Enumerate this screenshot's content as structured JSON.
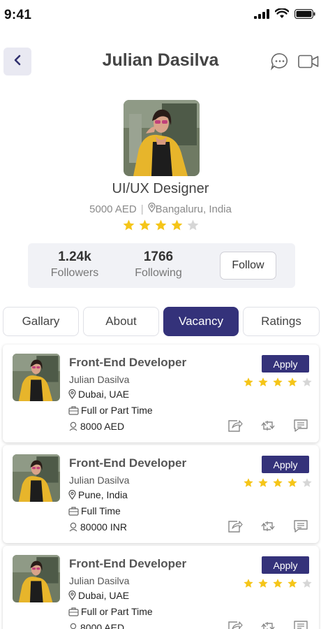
{
  "status": {
    "time": "9:41"
  },
  "header": {
    "title": "Julian Dasilva"
  },
  "profile": {
    "role": "UI/UX Designer",
    "salary": "5000 AED",
    "location": "Bangaluru, India",
    "rating": 4,
    "rating_max": 5
  },
  "stats": {
    "followers_count": "1.24k",
    "followers_label": "Followers",
    "following_count": "1766",
    "following_label": "Following",
    "follow_label": "Follow"
  },
  "tabs": [
    {
      "label": "Gallary",
      "active": false
    },
    {
      "label": "About",
      "active": false
    },
    {
      "label": "Vacancy",
      "active": true
    },
    {
      "label": "Ratings",
      "active": false
    }
  ],
  "jobs": [
    {
      "title": "Front-End Developer",
      "company": "Julian Dasilva",
      "location": "Dubai, UAE",
      "type": "Full or Part Time",
      "salary": "8000 AED",
      "apply_label": "Apply",
      "rating": 4
    },
    {
      "title": "Front-End Developer",
      "company": "Julian Dasilva",
      "location": "Pune, India",
      "type": "Full Time",
      "salary": "80000 INR",
      "apply_label": "Apply",
      "rating": 4
    },
    {
      "title": "Front-End Developer",
      "company": "Julian Dasilva",
      "location": "Dubai, UAE",
      "type": "Full or Part Time",
      "salary": "8000 AED",
      "apply_label": "Apply",
      "rating": 4
    }
  ],
  "colors": {
    "accent": "#34327a",
    "star_filled": "#f5c518",
    "star_empty": "#d6d6d6"
  }
}
